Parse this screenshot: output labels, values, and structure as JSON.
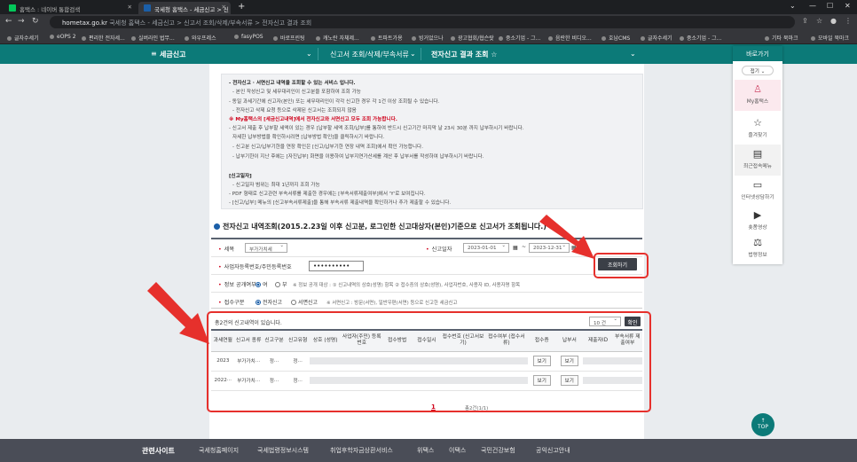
{
  "browser": {
    "tabs": [
      {
        "title": "홈택스 : 네이버 통합검색"
      },
      {
        "title": "국세청 홈택스 - 세금신고 > 신"
      }
    ],
    "url_host": "hometax.go.kr",
    "url_path": "  국세청 홈택스 - 세금신고 > 신고서 조회/삭제/부속서류 > 전자신고 결과 조회",
    "bookmarks": [
      "글자수세기",
      "eOPS 2",
      "편리한 전자세...",
      "실버라인 법무...",
      "와우프레스",
      "fasyPOS",
      "바로프린팅",
      "캐노란 자체제...",
      "트파트가용",
      "빙거었으나",
      "광고협회/협슨랏",
      "중소기업 - 그...",
      "음란한 비디오...",
      "호남CMS",
      "글자수세기",
      "중소기업 - 그..."
    ],
    "bookmarks_right": [
      "기타 북마크",
      "모바일 북마크"
    ]
  },
  "site_nav": {
    "menu": "세금신고",
    "breadcrumb1": "신고서 조회/삭제/부속서류",
    "breadcrumb2": "전자신고 결과 조회 ☆"
  },
  "notice": {
    "lines": [
      "- 전자신고 · 서면신고 내역을 조회할 수 있는 서비스 입니다.",
      "- 본인 작성신고 및 세무대리인이 신고분을 포함하여 조회 가능",
      "- 동일 과세기간에 신고자(본인) 또는 세무대리인이 각각 신고한 경우 각 1건 이상 조회될 수 있습니다.",
      "- 전자신고 삭제 요청 등으로 삭제된 신고서는 조회되지 않음",
      "※ My홈택스의 [세금신고내역]에서 전자신고와 서면신고 모두 조회 가능합니다.",
      "- 신고서 제출 후 납부할 세액이 있는 경우 [납부할 세액 조회/납부]를 통하여 반드시 신고기간 마지막 날 23시 30분 까지 납부하시기 바랍니다.",
      "자세한 납부방법을 확인하시려면 [납부방법 확인]을 클릭하시기 바랍니다.",
      "- 신고분 신고/납부기한을 연장 확인은 [신고/납부기한 연장 내역 조회]에서 확인 가능합니다.",
      "- 납부기한이 지난 후에는 [자진납부] 화면을 이용하여 납부지연가산세를 계산 후 납부서를 작성하여 납부하시기 바랍니다.",
      "[신고일자]",
      "- 신고일자 범위는 최대 1년까지 조회 가능",
      "- PDF 형태로 신고관련 부속서류를 제출한 경우에는 [부속서류제출여부]에서 'Y'로 보여집니다.",
      "- [신고/납부] 메뉴의 [신고부속서류제출]을 통해 부속서류 제출내역을 확인하거나 추가 제출할 수 있습니다."
    ]
  },
  "section_title": "전자신고 내역조회(2015.2.23일 이후 신고분, 로그인한  신고대상자(본인)기준으로  신고서가 조회됩니다.)",
  "filters": {
    "tax_label": "세목",
    "tax_value": "부가가치세",
    "date_label": "신고일자",
    "date_from": "2023-01-01",
    "date_sep": "~",
    "date_to": "2023-12-31",
    "id_label": "사업자등록번호/주민등록번호",
    "id_value": "••••••••••",
    "disclose_label": "정보 공개여부",
    "disclose_yes": "여",
    "disclose_no": "부",
    "disclose_note": "※ 정보 공개 대상 : ① 신고내역의 상호(성명) 항목 ② 접수증의 상호(성명), 사업자번호, 사용자 ID, 사용자명 항목",
    "receipt_label": "접수구분",
    "receipt_electronic": "전자신고",
    "receipt_paper": "서면신고",
    "receipt_note": "※ 서면신고 : 방문(서면), 일반우편(서면) 등으로 신고한 세금신고",
    "search_button": "조회하기"
  },
  "results": {
    "count_text": "총2건의 신고내역이 있습니다.",
    "page_size": "10 건",
    "confirm_button": "확인",
    "columns": [
      "과세연월",
      "신고서 종류",
      "신고구분",
      "신고유형",
      "상호 (성명)",
      "사업자(주민) 등록번호",
      "접수방법",
      "접수일시",
      "접수번호 (신고서보기)",
      "접수여부 (접수서류)",
      "접수증",
      "납부서",
      "제출자ID",
      "부속서류 제출여부"
    ],
    "rows": [
      {
        "period": "2023",
        "kind": "부가가치···",
        "gubun": "정···",
        "type": "정···",
        "receipt_btn": "보기",
        "pay_btn": "보기"
      },
      {
        "period": "2022···",
        "kind": "부가가치···",
        "gubun": "정···",
        "type": "정···",
        "receipt_btn": "보기",
        "pay_btn": "보기"
      }
    ],
    "page_current": "1",
    "page_info": "총2건(1/1)"
  },
  "right_panel": {
    "title": "바로가기",
    "collapse": "접기 ⌄",
    "items": [
      "My홈택스",
      "즐겨찾기",
      "최근접속메뉴",
      "인터넷상담하기",
      "숏폼영상",
      "법령정보"
    ]
  },
  "top_button": "TOP",
  "footer": {
    "title": "관련사이트",
    "links": [
      "국세청홈페이지",
      "국세법령정보시스템",
      "취업후학자금상환서비스",
      "위택스",
      "이택스",
      "국민건강보험",
      "공익신고안내"
    ]
  },
  "colors": {
    "brand": "#0c7a78",
    "callout": "#e6302c",
    "link": "#0b58c8"
  }
}
